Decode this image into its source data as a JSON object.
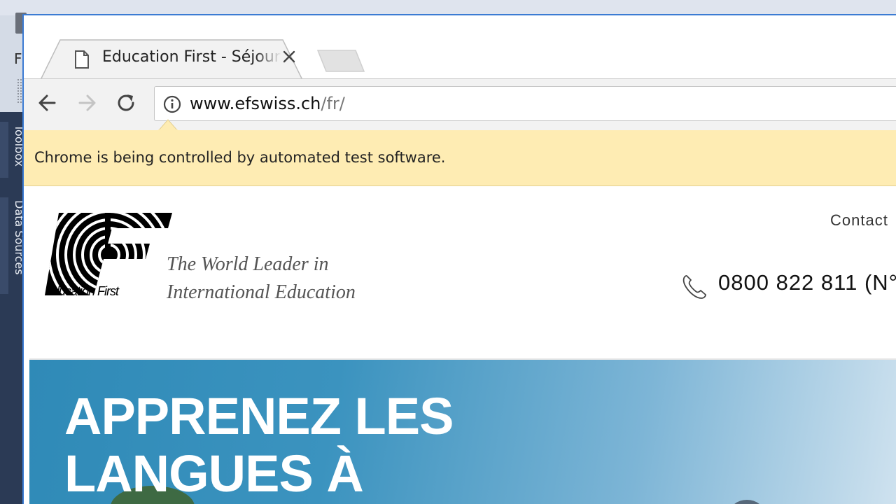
{
  "background_app": {
    "menu_letter": "F",
    "side_panels": [
      "Toolbox",
      "Data Sources"
    ]
  },
  "browser": {
    "tab": {
      "title": "Education First - Séjours linguistiques",
      "close_icon": "close-icon",
      "favicon": "document-icon"
    },
    "toolbar": {
      "back_icon": "arrow-left-icon",
      "forward_icon": "arrow-right-icon",
      "reload_icon": "reload-icon",
      "site_info_icon": "info-icon"
    },
    "address": {
      "host": "www.efswiss.ch",
      "path": "/fr/"
    },
    "infobar": {
      "message": "Chrome is being controlled by automated test software."
    }
  },
  "site": {
    "logo_caption": "Education First",
    "tagline": "The World Leader in International Education",
    "contact_label": "Contact",
    "phone": "0800 822 811 (N°",
    "hero_title": "APPRENEZ LES LANGUES À"
  },
  "colors": {
    "infobar_bg": "#feecb3",
    "window_border": "#3b7bd3",
    "hero_blue": "#2f8ab7"
  }
}
